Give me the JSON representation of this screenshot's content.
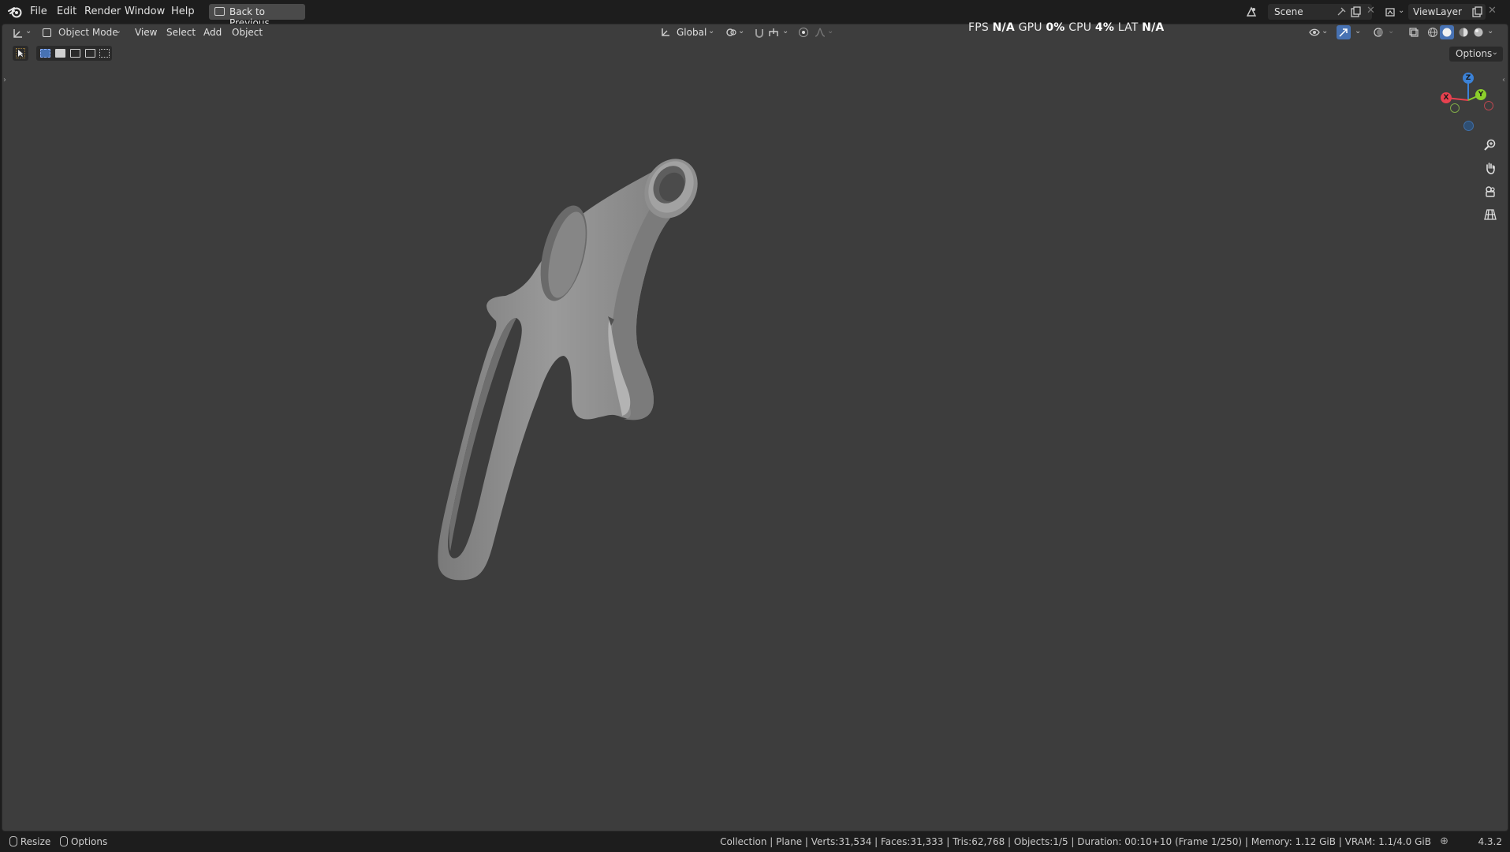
{
  "menu": {
    "items": [
      "File",
      "Edit",
      "Render",
      "Window",
      "Help"
    ],
    "back_button": "Back to Previous"
  },
  "workspace": {
    "scene": "Scene",
    "view_layer": "ViewLayer"
  },
  "viewport_header": {
    "mode": "Object Mode",
    "menus": [
      "View",
      "Select",
      "Add",
      "Object"
    ],
    "transform_orientation": "Global",
    "options_label": "Options"
  },
  "perf_stats": {
    "fps_label": "FPS",
    "fps_value": "N/A",
    "gpu_label": "GPU",
    "gpu_value": "0%",
    "cpu_label": "CPU",
    "cpu_value": "4%",
    "lat_label": "LAT",
    "lat_value": "N/A"
  },
  "gizmo": {
    "axes": [
      "X",
      "Y",
      "Z"
    ],
    "colors": {
      "x": "#e8414f",
      "y": "#8ccf2b",
      "z": "#3b82d8"
    }
  },
  "status_bar": {
    "resize_label": "Resize",
    "options_label": "Options",
    "info": "Collection | Plane | Verts:31,534 | Faces:31,333 | Tris:62,768 | Objects:1/5 | Duration: 00:10+10 (Frame 1/250) | Memory: 1.12 GiB | VRAM: 1.1/4.0 GiB",
    "version": "4.3.2"
  },
  "icons": [
    "blender-logo-icon",
    "editor-type-icon",
    "object-mode-icon",
    "transform-orientation-icon",
    "pivot-icon",
    "snap-icon",
    "proportional-edit-icon",
    "visibility-icon",
    "gizmo-icon",
    "overlay-icon",
    "xray-icon",
    "shading-wireframe-icon",
    "shading-solid-icon",
    "shading-material-icon",
    "shading-rendered-icon",
    "zoom-icon",
    "pan-hand-icon",
    "camera-view-icon",
    "perspective-grid-icon"
  ],
  "colors": {
    "viewport_bg": "#3d3d3d",
    "ui_bg": "#1d1d1d",
    "accent": "#4772b3",
    "object": "#8e8e8e"
  }
}
